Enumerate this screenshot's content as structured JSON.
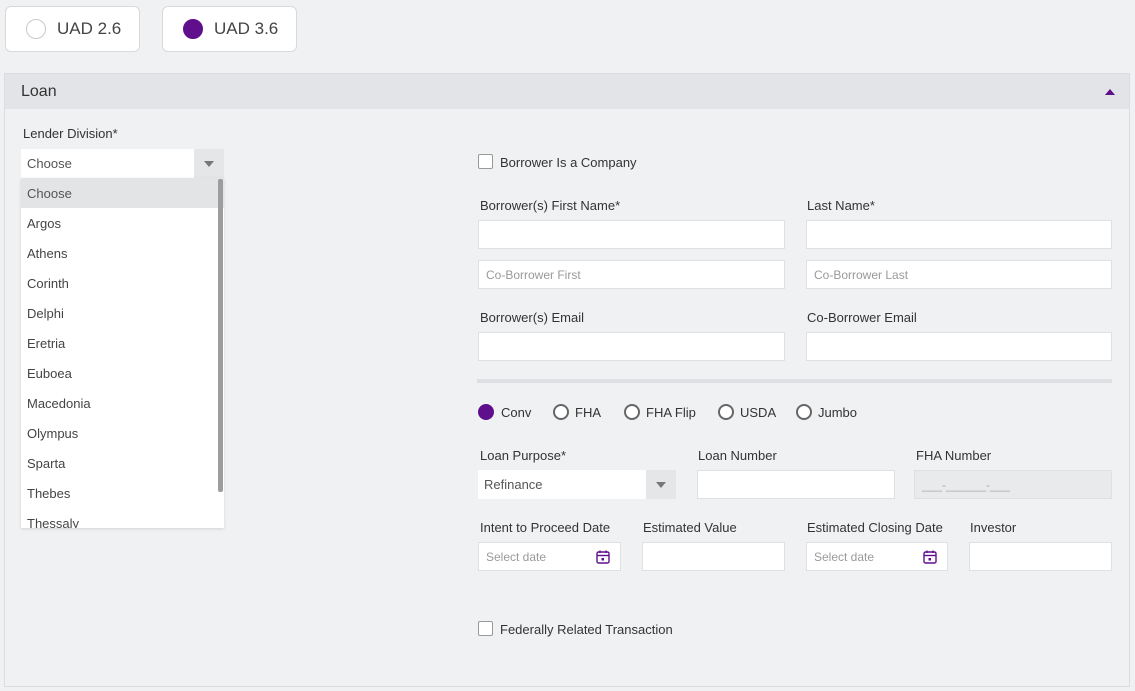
{
  "uad_toggle": {
    "options": [
      {
        "label": "UAD 2.6",
        "selected": false
      },
      {
        "label": "UAD 3.6",
        "selected": true
      }
    ]
  },
  "panel": {
    "title": "Loan"
  },
  "lender_division": {
    "label": "Lender Division*",
    "selected": "Choose",
    "options": [
      "Choose",
      "Argos",
      "Athens",
      "Corinth",
      "Delphi",
      "Eretria",
      "Euboea",
      "Macedonia",
      "Olympus",
      "Sparta",
      "Thebes",
      "Thessaly"
    ]
  },
  "borrower_is_company": {
    "label": "Borrower Is a Company",
    "checked": false
  },
  "borrower_first": {
    "label": "Borrower(s) First Name*",
    "value": ""
  },
  "last_name": {
    "label": "Last Name*",
    "value": ""
  },
  "co_borrower_first": {
    "placeholder": "Co-Borrower First"
  },
  "co_borrower_last": {
    "placeholder": "Co-Borrower Last"
  },
  "borrower_email": {
    "label": "Borrower(s) Email",
    "value": ""
  },
  "co_borrower_email": {
    "label": "Co-Borrower Email",
    "value": ""
  },
  "loan_types": [
    {
      "label": "Conv",
      "selected": true
    },
    {
      "label": "FHA",
      "selected": false
    },
    {
      "label": "FHA Flip",
      "selected": false
    },
    {
      "label": "USDA",
      "selected": false
    },
    {
      "label": "Jumbo",
      "selected": false
    }
  ],
  "loan_purpose": {
    "label": "Loan Purpose*",
    "selected": "Refinance"
  },
  "loan_number": {
    "label": "Loan Number",
    "value": ""
  },
  "fha_number": {
    "label": "FHA Number",
    "placeholder": "___-______-___"
  },
  "intent_to_proceed": {
    "label": "Intent to Proceed Date",
    "placeholder": "Select date"
  },
  "estimated_value": {
    "label": "Estimated Value",
    "value": ""
  },
  "estimated_closing": {
    "label": "Estimated Closing Date",
    "placeholder": "Select date"
  },
  "investor": {
    "label": "Investor",
    "value": ""
  },
  "federally_related": {
    "label": "Federally Related Transaction",
    "checked": false
  },
  "colors": {
    "accent": "#5f0f8c",
    "panel_header": "#e3e4e7",
    "background": "#f0f1f3"
  }
}
